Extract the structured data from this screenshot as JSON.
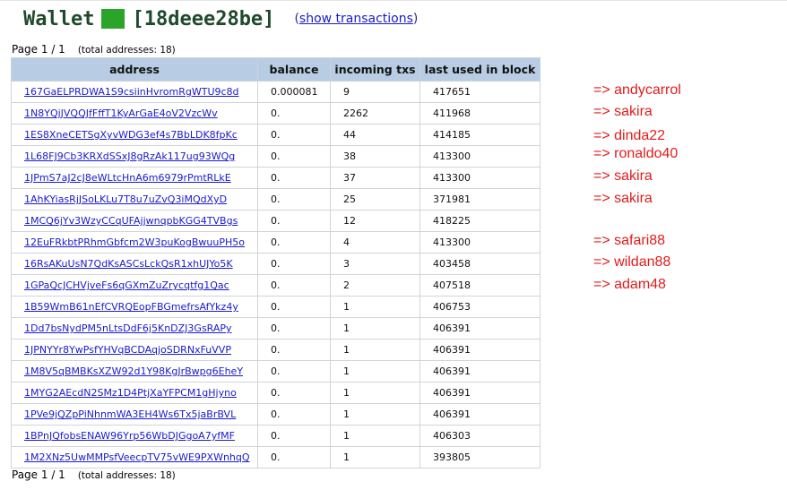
{
  "header": {
    "title": "Wallet",
    "wallet_id": "[18deee28be]",
    "show_transactions_prefix": "(",
    "show_transactions_label": "show transactions",
    "show_transactions_suffix": ")",
    "accent_color": "#2aa52a"
  },
  "pager": {
    "label": "Page 1 / 1",
    "total": "(total addresses: 18)"
  },
  "table": {
    "columns": [
      "address",
      "balance",
      "incoming txs",
      "last used in block"
    ],
    "rows": [
      {
        "address": "167GaELPRDWA1S9csiinHvromRgWTU9c8d",
        "balance": "0.000081",
        "incoming": "9",
        "block": "417651"
      },
      {
        "address": "1N8YQjJVQQJfFffT1KyArGaE4oV2VzcWv",
        "balance": "0.",
        "incoming": "2262",
        "block": "411968"
      },
      {
        "address": "1ES8XneCETSgXyvWDG3ef4s7BbLDK8fpKc",
        "balance": "0.",
        "incoming": "44",
        "block": "414185"
      },
      {
        "address": "1L68FJ9Cb3KRXdSSxJ8gRzAk117ug93WQg",
        "balance": "0.",
        "incoming": "38",
        "block": "413300"
      },
      {
        "address": "1JPmS7aJ2cJ8eWLtcHnA6m6979rPmtRLkE",
        "balance": "0.",
        "incoming": "37",
        "block": "413300"
      },
      {
        "address": "1AhKYiasRjJSoLKLu7T8u7uZvQ3iMQdXyD",
        "balance": "0.",
        "incoming": "25",
        "block": "371981"
      },
      {
        "address": "1MCQ6jYv3WzyCCqUFAjjwnqpbKGG4TVBgs",
        "balance": "0.",
        "incoming": "12",
        "block": "418225"
      },
      {
        "address": "12EuFRkbtPRhmGbfcm2W3puKogBwuuPH5o",
        "balance": "0.",
        "incoming": "4",
        "block": "413300"
      },
      {
        "address": "16RsAKuUsN7QdKsASCsLckQsR1xhUJYo5K",
        "balance": "0.",
        "incoming": "3",
        "block": "403458"
      },
      {
        "address": "1GPaQcJCHVjveFs6qGXmZuZrycqtfg1Qac",
        "balance": "0.",
        "incoming": "2",
        "block": "407518"
      },
      {
        "address": "1B59WmB61nEfCVRQEopFBGmefrsAfYkz4y",
        "balance": "0.",
        "incoming": "1",
        "block": "406753"
      },
      {
        "address": "1Dd7bsNydPM5nLtsDdF6j5KnDZJ3GsRAPy",
        "balance": "0.",
        "incoming": "1",
        "block": "406391"
      },
      {
        "address": "1JPNYYr8YwPsfYHVqBCDAqjoSDRNxFuVVP",
        "balance": "0.",
        "incoming": "1",
        "block": "406391"
      },
      {
        "address": "1M8V5qBMBKsXZW92d1Y98KgJrBwpg6EheY",
        "balance": "0.",
        "incoming": "1",
        "block": "406391"
      },
      {
        "address": "1MYG2AEcdN2SMz1D4PtjXaYFPCM1gHjyno",
        "balance": "0.",
        "incoming": "1",
        "block": "406391"
      },
      {
        "address": "1PVe9jQZpPiNhnmWA3EH4Ws6Tx5jaBrBVL",
        "balance": "0.",
        "incoming": "1",
        "block": "406391"
      },
      {
        "address": "1BPnJQfobsENAW96Yrp56WbDJGgoA7yfMF",
        "balance": "0.",
        "incoming": "1",
        "block": "406303"
      },
      {
        "address": "1M2XNz5UwMMPsfVeecpTV75vWE9PXWnhqQ",
        "balance": "0.",
        "incoming": "1",
        "block": "393805"
      }
    ]
  },
  "annotations": [
    {
      "text": "=> andycarrol"
    },
    {
      "text": "=> sakira"
    },
    {
      "text": "=> dinda22"
    },
    {
      "text": "=> ronaldo40"
    },
    {
      "text": "=> sakira"
    },
    {
      "text": "=> sakira"
    },
    {
      "text": "=> safari88"
    },
    {
      "text": "=> wildan88"
    },
    {
      "text": "=> adam48"
    }
  ]
}
